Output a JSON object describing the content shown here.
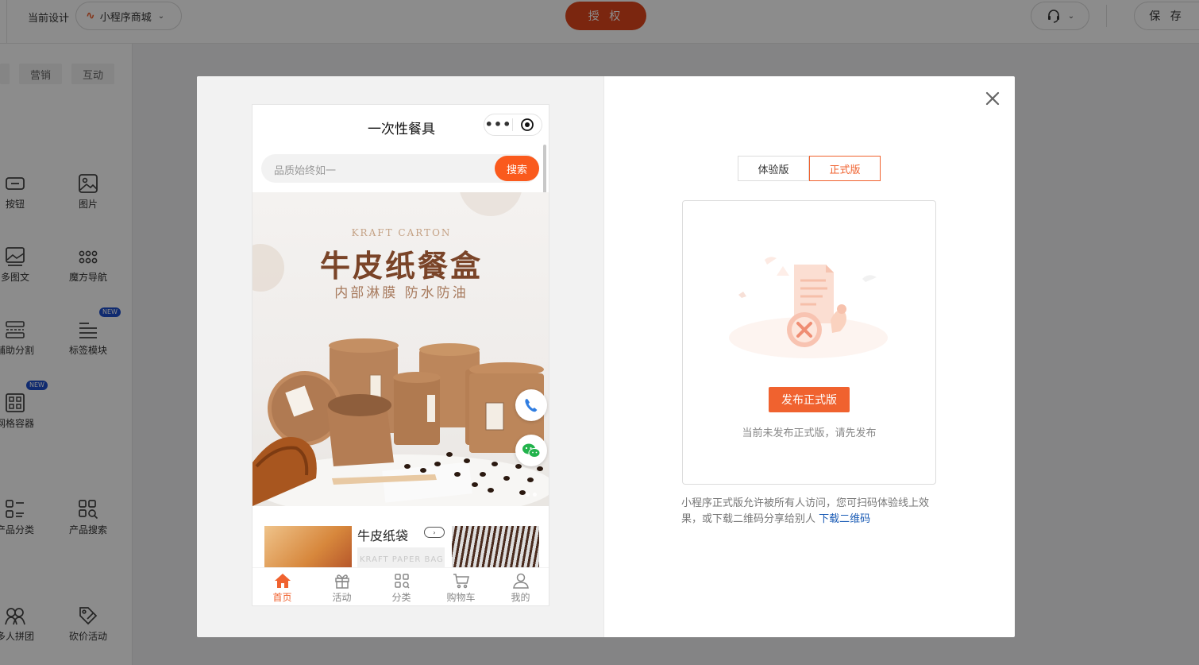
{
  "topbar": {
    "current_design_label": "当前设计",
    "app_name": "小程序商城",
    "authorize_button": "授 权",
    "save_button": "保 存"
  },
  "sidebar": {
    "tabs": [
      "",
      "营销",
      "互动"
    ],
    "components": [
      {
        "label": "按钮",
        "icon": "button-icon"
      },
      {
        "label": "图片",
        "icon": "image-icon"
      },
      {
        "label": "多图文",
        "icon": "multi-image-text-icon"
      },
      {
        "label": "魔方导航",
        "icon": "grid-dots-icon"
      },
      {
        "label": "辅助分割",
        "icon": "divider-icon"
      },
      {
        "label": "标签模块",
        "icon": "tag-list-icon",
        "badge": "NEW"
      },
      {
        "label": "网格容器",
        "icon": "grid-container-icon",
        "badge": "NEW"
      },
      {
        "label": "产品分类",
        "icon": "category-icon"
      },
      {
        "label": "产品搜索",
        "icon": "product-search-icon"
      },
      {
        "label": "多人拼团",
        "icon": "group-buy-icon"
      },
      {
        "label": "砍价活动",
        "icon": "bargain-icon"
      }
    ]
  },
  "phone": {
    "title": "一次性餐具",
    "search_placeholder": "品质始终如一",
    "search_button": "搜索",
    "banner": {
      "english_title": "KRAFT CARTON",
      "title": "牛皮纸餐盒",
      "subtitle": "内部淋膜 防水防油"
    },
    "product_section_title": "牛皮纸袋",
    "product_mid_text": "KRAFT PAPER BAG",
    "tabbar": [
      {
        "label": "首页",
        "icon": "home-icon",
        "active": true
      },
      {
        "label": "活动",
        "icon": "gift-icon",
        "active": false
      },
      {
        "label": "分类",
        "icon": "category-icon",
        "active": false
      },
      {
        "label": "购物车",
        "icon": "cart-icon",
        "active": false
      },
      {
        "label": "我的",
        "icon": "user-icon",
        "active": false
      }
    ]
  },
  "modal": {
    "version_tabs": [
      {
        "label": "体验版",
        "active": false
      },
      {
        "label": "正式版",
        "active": true
      }
    ],
    "publish_button": "发布正式版",
    "not_published_hint": "当前未发布正式版，请先发布",
    "description": "小程序正式版允许被所有人访问，您可扫码体验线上效果，或下载二维码分享给别人",
    "download_link": "下载二维码"
  },
  "colors": {
    "accent": "#f0622f",
    "authorize": "#e0451c",
    "link": "#1a5bb5",
    "new_badge": "#1e4fcc"
  }
}
